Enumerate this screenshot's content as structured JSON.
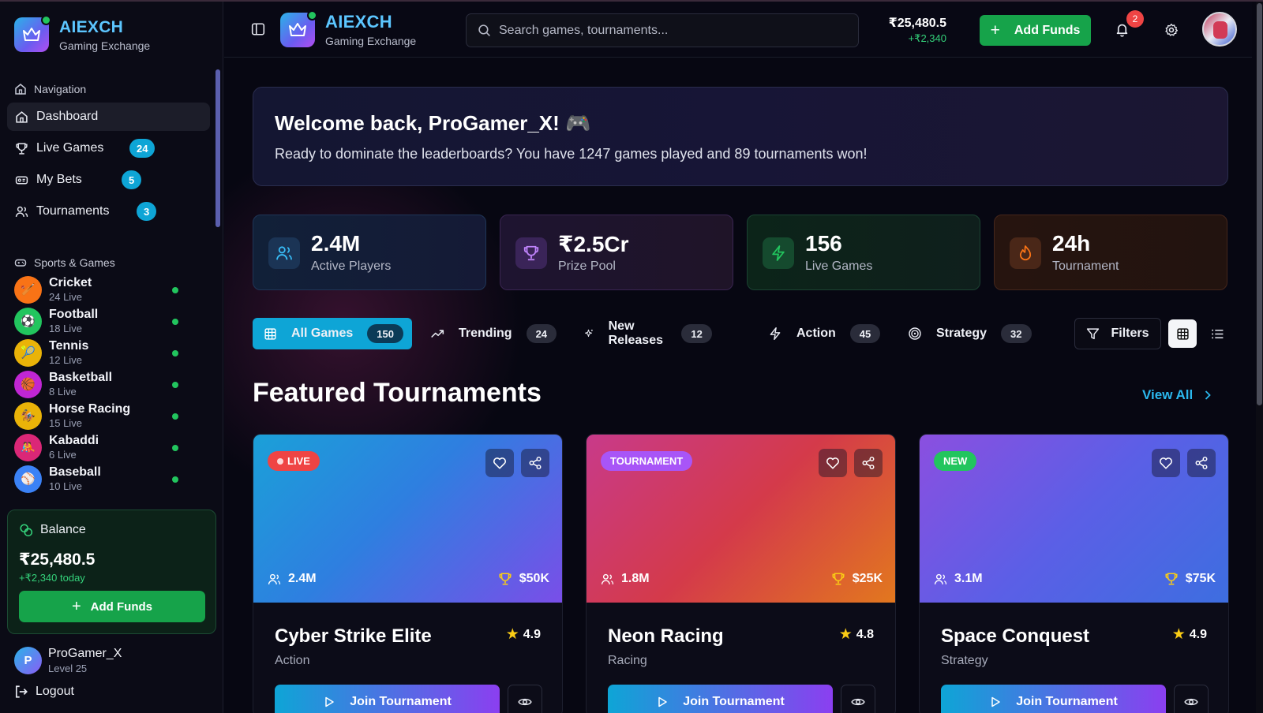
{
  "brand": {
    "title": "AIEXCH",
    "subtitle": "Gaming Exchange"
  },
  "sidebar": {
    "nav_label": "Navigation",
    "items": [
      {
        "label": "Dashboard",
        "icon": "home-icon",
        "badge": ""
      },
      {
        "label": "Live Games",
        "icon": "trophy-icon",
        "badge": "24"
      },
      {
        "label": "My Bets",
        "icon": "ticket-icon",
        "badge": "5"
      },
      {
        "label": "Tournaments",
        "icon": "users-icon",
        "badge": "3"
      }
    ],
    "sports_label": "Sports & Games",
    "sports": [
      {
        "name": "Cricket",
        "live": "24 Live",
        "icon": "🏏",
        "color": "#f97316"
      },
      {
        "name": "Football",
        "live": "18 Live",
        "icon": "⚽",
        "color": "#22c55e"
      },
      {
        "name": "Tennis",
        "live": "12 Live",
        "icon": "🎾",
        "color": "#eab308"
      },
      {
        "name": "Basketball",
        "live": "8 Live",
        "icon": "🏀",
        "color": "#c026d3"
      },
      {
        "name": "Horse Racing",
        "live": "15 Live",
        "icon": "🏇",
        "color": "#eab308"
      },
      {
        "name": "Kabaddi",
        "live": "6 Live",
        "icon": "🤼",
        "color": "#db2777"
      },
      {
        "name": "Baseball",
        "live": "10 Live",
        "icon": "⚾",
        "color": "#3b82f6"
      }
    ],
    "balance": {
      "label": "Balance",
      "amount": "₹25,480.5",
      "today": "+₹2,340 today",
      "button": "Add Funds"
    },
    "user": {
      "initial": "P",
      "name": "ProGamer_X",
      "level": "Level 25"
    },
    "logout": "Logout"
  },
  "header": {
    "search_placeholder": "Search games, tournaments...",
    "balance": "₹25,480.5",
    "balance_change": "+₹2,340",
    "add_funds": "Add Funds",
    "notifications": "2"
  },
  "welcome": {
    "title": "Welcome back, ProGamer_X! 🎮",
    "message": "Ready to dominate the leaderboards? You have 1247 games played and 89 tournaments won!"
  },
  "stats": [
    {
      "value": "2.4M",
      "label": "Active Players",
      "icon": "users-icon",
      "accent": "#38bdf8"
    },
    {
      "value": "₹2.5Cr",
      "label": "Prize Pool",
      "icon": "trophy-icon",
      "accent": "#c084fc"
    },
    {
      "value": "156",
      "label": "Live Games",
      "icon": "zap-icon",
      "accent": "#22c55e"
    },
    {
      "value": "24h",
      "label": "Tournament",
      "icon": "flame-icon",
      "accent": "#f97316"
    }
  ],
  "filters": [
    {
      "label": "All Games",
      "count": "150",
      "icon": "grid-icon",
      "active": true
    },
    {
      "label": "Trending",
      "count": "24",
      "icon": "trending-icon"
    },
    {
      "label": "New Releases",
      "count": "12",
      "icon": "sparkle-icon"
    },
    {
      "label": "Action",
      "count": "45",
      "icon": "zap-icon"
    },
    {
      "label": "Strategy",
      "count": "32",
      "icon": "target-icon"
    }
  ],
  "filter_button": "Filters",
  "featured": {
    "title": "Featured Tournaments",
    "view_all": "View All",
    "cards": [
      {
        "tag": "LIVE",
        "tag_color": "#ef4444",
        "players": "2.4M",
        "prize": "$50K",
        "title": "Cyber Strike Elite",
        "genre": "Action",
        "rating": "4.9",
        "button": "Join Tournament"
      },
      {
        "tag": "TOURNAMENT",
        "tag_color": "#a855f7",
        "players": "1.8M",
        "prize": "$25K",
        "title": "Neon Racing",
        "genre": "Racing",
        "rating": "4.8",
        "button": "Join Tournament"
      },
      {
        "tag": "NEW",
        "tag_color": "#22c55e",
        "players": "3.1M",
        "prize": "$75K",
        "title": "Space Conquest",
        "genre": "Strategy",
        "rating": "4.9",
        "button": "Join Tournament"
      }
    ]
  }
}
